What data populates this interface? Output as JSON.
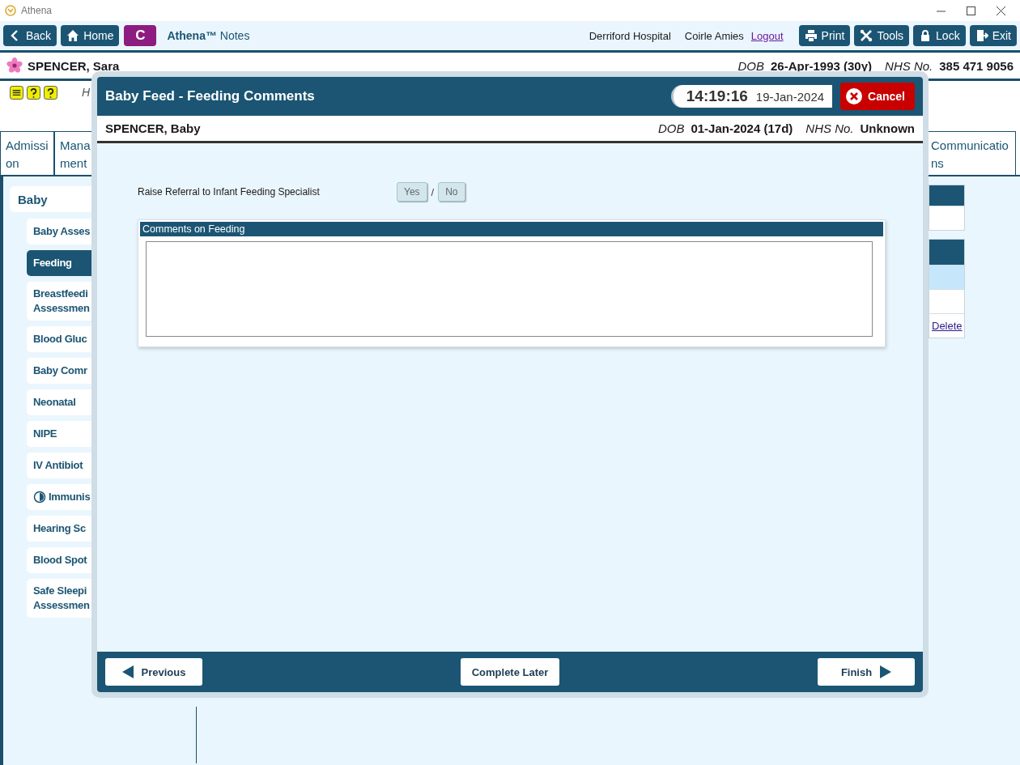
{
  "window": {
    "title": "Athena"
  },
  "toolbar": {
    "nav": [
      {
        "label": "Back",
        "kind": "back"
      },
      {
        "label": "Home",
        "kind": "home"
      }
    ],
    "badge": "C",
    "app_name": "**Athena™** Notes",
    "hospital": "Derriford Hospital",
    "user": "Coirle Amies",
    "logout": "Logout",
    "actions": [
      {
        "label": "Print",
        "kind": "print"
      },
      {
        "label": "Tools",
        "kind": "tools"
      },
      {
        "label": "Lock",
        "kind": "lock"
      },
      {
        "label": "Exit",
        "kind": "exit"
      }
    ]
  },
  "patient": {
    "name": "SPENCER, Sara",
    "dob_label": "DOB",
    "dob": "26-Apr-1993 (30y)",
    "nhs_label": "NHS No.",
    "nhs": "385 471 9056"
  },
  "alerts": {
    "fragment": "H"
  },
  "tabs": [
    {
      "label": "Admission",
      "selected": false
    },
    {
      "label": "Mana ment",
      "selected": false
    },
    {
      "label": "Communications",
      "selected": false
    }
  ],
  "sidebar": {
    "group": "Baby",
    "items": [
      {
        "lines": [
          "Baby Asses"
        ],
        "selected": false,
        "status_icon": false
      },
      {
        "lines": [
          "Feeding"
        ],
        "selected": true,
        "status_icon": false
      },
      {
        "lines": [
          "Breastfeedi",
          "Assessmen"
        ],
        "selected": false,
        "status_icon": false
      },
      {
        "lines": [
          "Blood Gluc"
        ],
        "selected": false,
        "status_icon": false
      },
      {
        "lines": [
          "Baby Comr"
        ],
        "selected": false,
        "status_icon": false
      },
      {
        "lines": [
          "Neonatal"
        ],
        "selected": false,
        "status_icon": false
      },
      {
        "lines": [
          "NIPE"
        ],
        "selected": false,
        "status_icon": false
      },
      {
        "lines": [
          "IV Antibiot"
        ],
        "selected": false,
        "status_icon": false
      },
      {
        "lines": [
          "Immunis"
        ],
        "selected": false,
        "status_icon": true
      },
      {
        "lines": [
          "Hearing Sc"
        ],
        "selected": false,
        "status_icon": false
      },
      {
        "lines": [
          "Blood Spot"
        ],
        "selected": false,
        "status_icon": false
      },
      {
        "lines": [
          "Safe Sleepi",
          "Assessmen"
        ],
        "selected": false,
        "status_icon": false
      }
    ]
  },
  "right_panel": {
    "link": "Delete"
  },
  "dialog": {
    "title": "Baby Feed - Feeding Comments",
    "time": "14:19:16",
    "date": "19-Jan-2024",
    "cancel": "Cancel",
    "patient": {
      "name": "SPENCER, Baby",
      "dob_label": "DOB",
      "dob": "01-Jan-2024 (17d)",
      "nhs_label": "NHS No.",
      "nhs": "Unknown"
    },
    "question": {
      "label": "Raise Referral to Infant Feeding Specialist",
      "separator": "/",
      "options": [
        {
          "label": "Yes",
          "selected": false
        },
        {
          "label": "No",
          "selected": false
        }
      ]
    },
    "comments": {
      "title": "Comments on Feeding"
    },
    "footer": {
      "previous": "Previous",
      "later": "Complete Later",
      "finish": "Finish"
    }
  }
}
